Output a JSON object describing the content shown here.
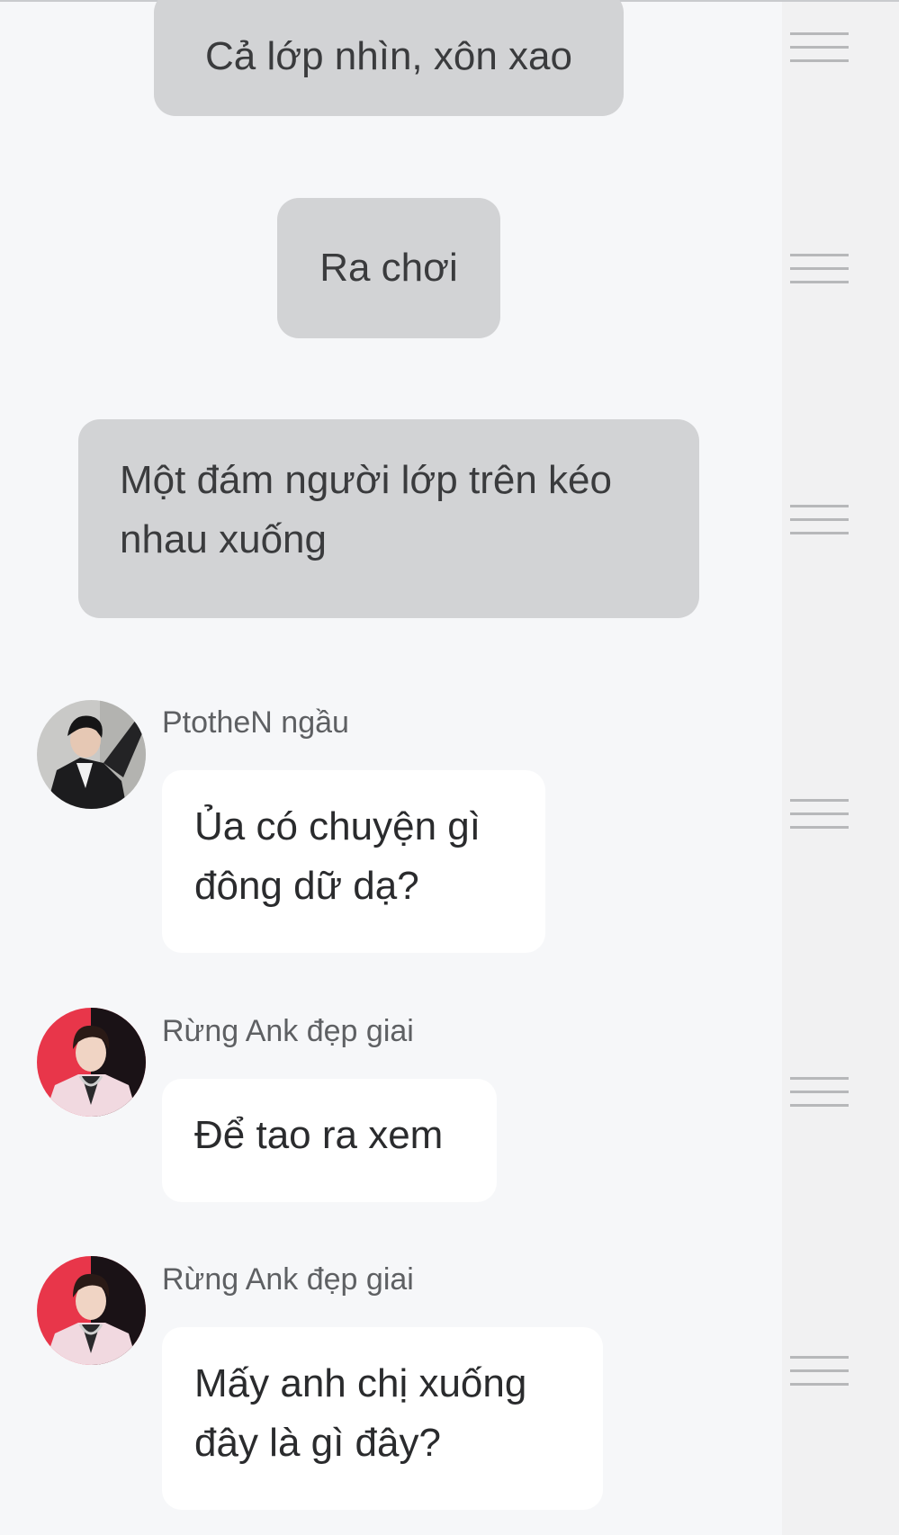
{
  "narrations": [
    {
      "text": "Cả lớp nhìn, xôn xao"
    },
    {
      "text": "Ra chơi"
    },
    {
      "text": "Một đám người lớp trên kéo nhau xuống"
    }
  ],
  "messages": [
    {
      "sender": "PtotheN ngầu",
      "text": "Ủa có chuyện gì đông dữ dạ?",
      "avatar": "avatar-photo-boy-black-jacket"
    },
    {
      "sender": "Rừng Ank đẹp giai",
      "text": "Để tao ra xem",
      "avatar": "avatar-photo-boy-pink-suit"
    },
    {
      "sender": "Rừng Ank đẹp giai",
      "text": "Mấy anh chị xuống đây là gì đây?",
      "avatar": "avatar-photo-boy-pink-suit"
    }
  ],
  "icons": {
    "reorder": "drag-handle-icon"
  },
  "colors": {
    "background": "#f6f7f9",
    "narration_bubble": "#d2d3d5",
    "message_bubble": "#ffffff",
    "sender_text": "#5e6063",
    "handle": "#b7b8ba"
  }
}
